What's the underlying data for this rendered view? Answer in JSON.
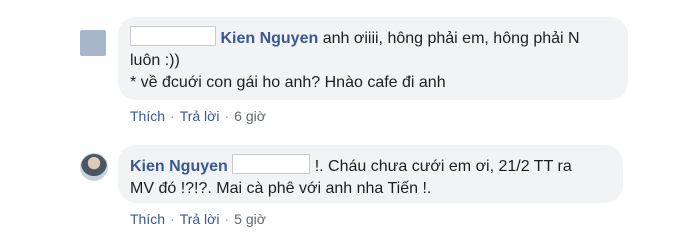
{
  "comments": [
    {
      "author": "Kien Nguyen",
      "line1_after": "anh ơiiii, hông phải em, hông phải N",
      "line2": "luôn :))",
      "line3": "* về đcuới con gái ho anh? Hnào cafe đi anh",
      "like_label": "Thích",
      "reply_label": "Trả lời",
      "time": "6 giờ"
    },
    {
      "author": "Kien Nguyen",
      "line1_after": "!. Cháu chưa cưới em ơi, 21/2 TT ra",
      "line2": "MV đó !?!?. Mai cà phê với anh nha Tiến !.",
      "like_label": "Thích",
      "reply_label": "Trả lời",
      "time": "5 giờ"
    }
  ]
}
